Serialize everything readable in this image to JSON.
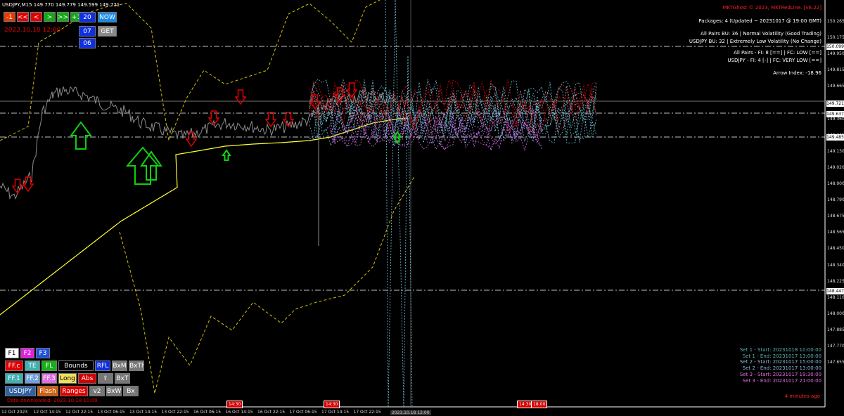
{
  "chart_title": "USDJPY,M15  149.770 149.779 149.599 149.721",
  "nav_buttons": [
    {
      "label": "-1",
      "bg": "#e53a00"
    },
    {
      "label": "<<",
      "bg": "#e00000"
    },
    {
      "label": "<",
      "bg": "#e00000"
    },
    {
      "label": ">",
      "bg": "#14a814"
    },
    {
      "label": ">>",
      "bg": "#14a814"
    },
    {
      "label": "+1",
      "bg": "#14a814"
    }
  ],
  "time_buttons": [
    {
      "label": "20",
      "bg": "#1030e0"
    },
    {
      "label": "NOW",
      "bg": "#1a8ae6"
    },
    {
      "label": "07",
      "bg": "#1030e0"
    },
    {
      "label": "GET",
      "bg": "#8a8a8a"
    },
    {
      "label": "06",
      "bg": "#1030e0"
    }
  ],
  "current_date": "2023.10.18 12:00",
  "header": "MKTGhost © 2023, MKTRedLine. [v6.22]",
  "info_lines": [
    "Packages: 4 (Updated ~ 20231017 @ 19:00 GMT)",
    "All Pairs BU: 36 | Normal Volatility (Good Trading)",
    "USDJPY BU: 32 | Extremely Low Volatility (No Change)",
    "All Pairs - FI: 8 [==] | FC: LOW [==]",
    "USDJPY - FI: 4 [-] | FC: VERY LOW [==]",
    "Arrow Index: -18.96"
  ],
  "sets": [
    {
      "text": "Set 1 - Start: 20231018 10:00:00",
      "color": "#5fb0b0"
    },
    {
      "text": "Set 1 - End: 20231017 13:00:00",
      "color": "#5fb0b0"
    },
    {
      "text": "Set 2 - Start: 20231017 15:00:00",
      "color": "#8ab8d8"
    },
    {
      "text": "Set 2 - End: 20231017 13:00:00",
      "color": "#8ab8d8"
    },
    {
      "text": "Set 3 - Start: 20231017 19:30:00",
      "color": "#e070e0"
    },
    {
      "text": "Set 3 - End: 20231017 21:00:00",
      "color": "#e070e0"
    }
  ],
  "panel_rows": [
    [
      {
        "label": "F1",
        "bg": "#ffffff",
        "fg": "#000"
      },
      {
        "label": "F2",
        "bg": "#e020e0",
        "fg": "#fff"
      },
      {
        "label": "F3",
        "bg": "#2050e0",
        "fg": "#fff"
      }
    ],
    [
      {
        "label": "FF.c",
        "bg": "#e00000",
        "fg": "#fff"
      },
      {
        "label": "TE",
        "bg": "#40b0b0",
        "fg": "#fff"
      },
      {
        "label": "FL",
        "bg": "#18b018",
        "fg": "#fff"
      },
      {
        "label": "Bounds",
        "bg": "#000000",
        "fg": "#fff"
      },
      {
        "label": "RFL",
        "bg": "#1030e0",
        "fg": "#fff"
      },
      {
        "label": "BxM",
        "bg": "#777777",
        "fg": "#fff"
      },
      {
        "label": "BxTh",
        "bg": "#777777",
        "fg": "#fff"
      }
    ],
    [
      {
        "label": "FF.1",
        "bg": "#40b0b0",
        "fg": "#fff"
      },
      {
        "label": "FF.2",
        "bg": "#70a0e0",
        "fg": "#fff"
      },
      {
        "label": "FF.3",
        "bg": "#e070e0",
        "fg": "#fff"
      },
      {
        "label": "Long",
        "bg": "#f0e060",
        "fg": "#000"
      },
      {
        "label": "Abs",
        "bg": "#d00000",
        "fg": "#fff"
      },
      {
        "label": "⇧",
        "bg": "#777777",
        "fg": "#fff"
      },
      {
        "label": "BxT",
        "bg": "#777777",
        "fg": "#fff"
      }
    ],
    [
      {
        "label": "USDJPY",
        "bg": "#3060a0",
        "fg": "#fff"
      },
      {
        "label": "Flash",
        "bg": "#d06010",
        "fg": "#fff"
      },
      {
        "label": "Ranges",
        "bg": "#e00000",
        "fg": "#fff"
      },
      {
        "label": "v2",
        "bg": "#777777",
        "fg": "#fff"
      },
      {
        "label": "BxW",
        "bg": "#777777",
        "fg": "#fff"
      },
      {
        "label": "Bx",
        "bg": "#777777",
        "fg": "#fff"
      }
    ]
  ],
  "download_text": "Data downloaded: 2023.10.18 10:09",
  "updated_ago": "4 minutes ago",
  "price_ticks": [
    "150.265",
    "150.175",
    "149.950",
    "149.815",
    "149.665",
    "149.485",
    "149.360",
    "149.245",
    "149.130",
    "149.020",
    "148.900",
    "148.790",
    "148.675",
    "148.565",
    "148.450",
    "148.340",
    "148.225",
    "148.110",
    "148.000",
    "147.885",
    "147.770",
    "147.655"
  ],
  "price_boxes": [
    "150.099",
    "149.721",
    "149.637",
    "149.485",
    "148.447"
  ],
  "time_labels": [
    "12 Oct 2023",
    "12 Oct 14:15",
    "12 Oct 22:15",
    "13 Oct 06:15",
    "13 Oct 14:15",
    "13 Oct 22:15",
    "16 Oct 06:15",
    "16 Oct 14:15",
    "16 Oct 22:15",
    "17 Oct 06:15",
    "17 Oct 14:15",
    "17 Oct 22:15"
  ],
  "time_tags": [
    "14:30",
    "14:30",
    "14:30",
    "18:00"
  ],
  "cursor_time": "2023.10.18 12:00",
  "colors": {
    "price": "#8c8c8c",
    "ma": "#ffff30",
    "envelope": "#d4c000",
    "red_forecast": "#e00000",
    "pink_forecast": "#d070f0",
    "cyan_forecast": "#70c0d8",
    "up_arrow": "#10d010",
    "down_arrow": "#e00000"
  }
}
